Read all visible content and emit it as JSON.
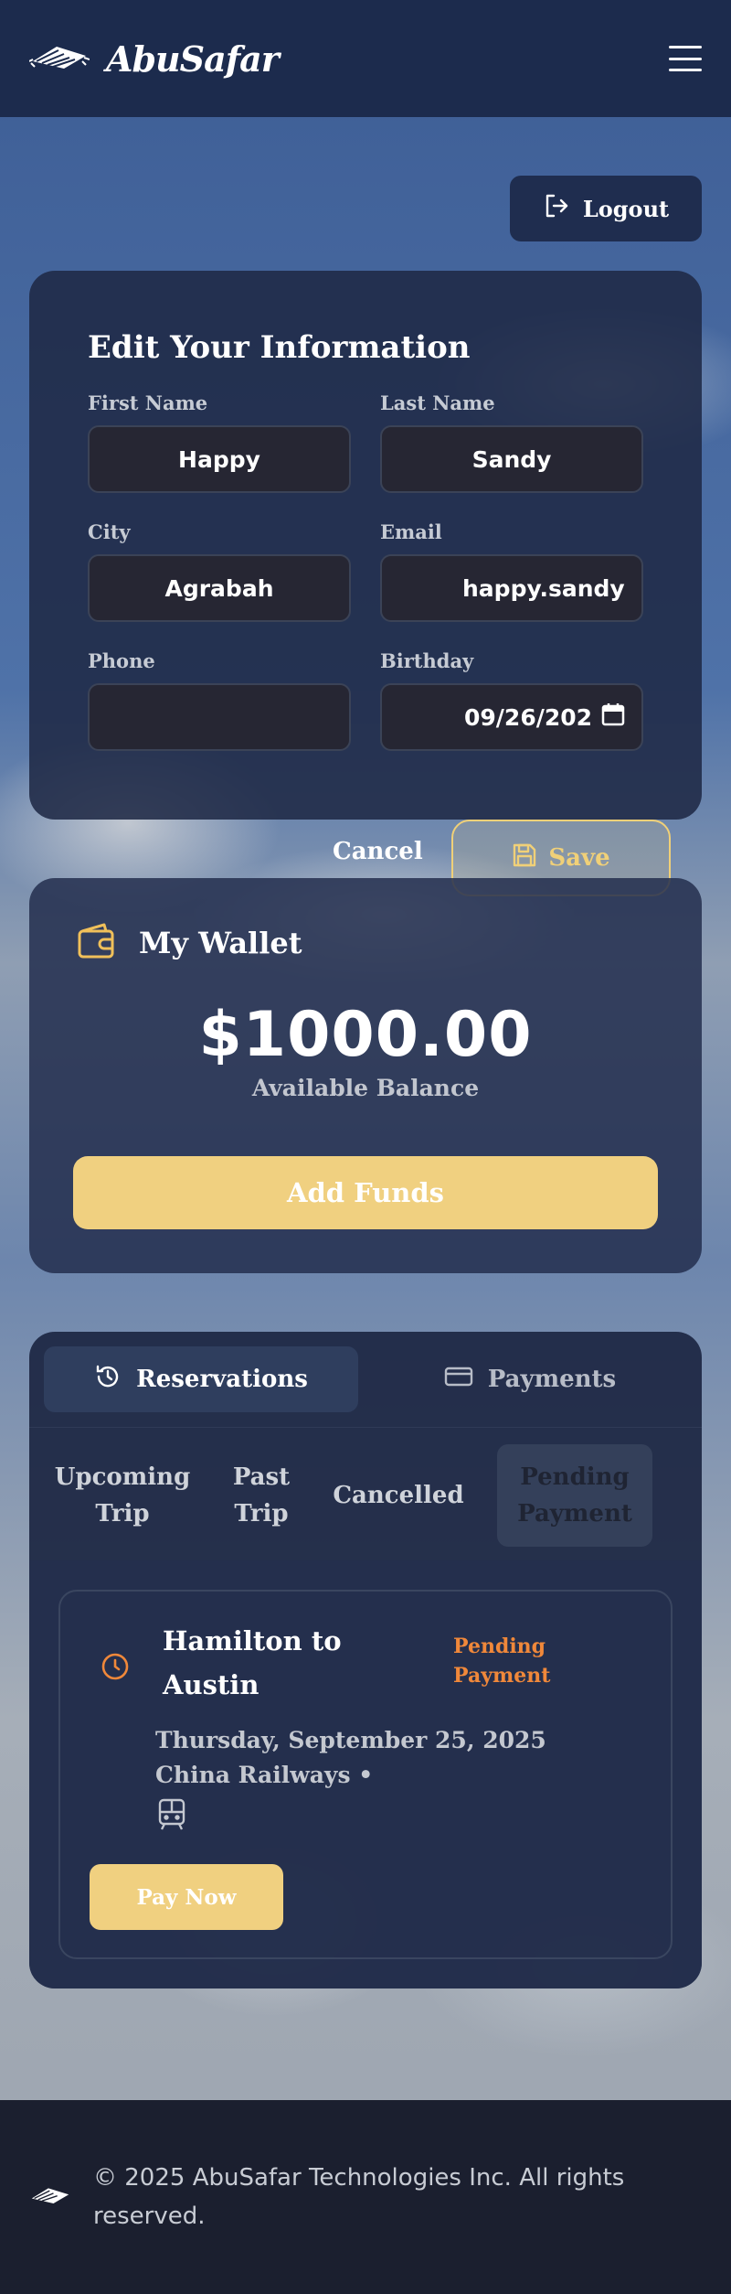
{
  "header": {
    "brand": "AbuSafar",
    "logo_icon": "magic-carpet-icon",
    "menu_icon": "hamburger-menu-icon"
  },
  "logout": {
    "label": "Logout",
    "icon": "logout-arrow-icon"
  },
  "profile_form": {
    "title": "Edit Your Information",
    "fields": {
      "first_name": {
        "label": "First Name",
        "value": "Happy"
      },
      "last_name": {
        "label": "Last Name",
        "value": "Sandy"
      },
      "city": {
        "label": "City",
        "value": "Agrabah"
      },
      "email": {
        "label": "Email",
        "value": "happy.sandy"
      },
      "phone": {
        "label": "Phone",
        "value": ""
      },
      "birthday": {
        "label": "Birthday",
        "value": "09/26/202"
      }
    },
    "cancel_label": "Cancel",
    "save_label": "Save"
  },
  "wallet": {
    "title": "My Wallet",
    "icon": "wallet-icon",
    "balance": "$1000.00",
    "balance_label": "Available Balance",
    "add_funds_label": "Add Funds"
  },
  "reservations": {
    "tabs": [
      {
        "label": "Reservations",
        "icon": "history-icon",
        "active": true
      },
      {
        "label": "Payments",
        "icon": "credit-card-icon",
        "active": false
      }
    ],
    "subtabs": [
      {
        "label": "Upcoming Trip"
      },
      {
        "label": "Past Trip"
      },
      {
        "label": "Cancelled"
      },
      {
        "label": "Pending Payment",
        "active": true
      }
    ],
    "trip": {
      "title": "Hamilton to Austin",
      "status": "Pending Payment",
      "date": "Thursday, September 25, 2025",
      "operator": "China Railways •",
      "transport_icon": "train-icon",
      "pay_label": "Pay Now"
    }
  },
  "footer": {
    "text": "© 2025 AbuSafar Technologies Inc. All rights reserved."
  },
  "colors": {
    "accent": "#f0d080",
    "pending": "#f0883a",
    "header_bg": "#1c2b4d"
  }
}
